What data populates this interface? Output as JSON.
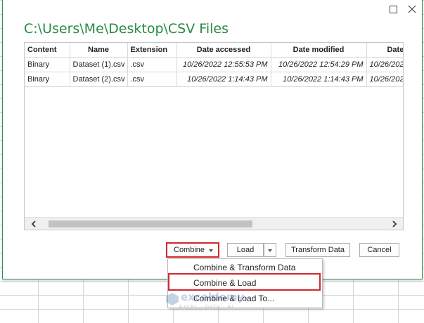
{
  "dialog": {
    "path_title": "C:\\Users\\Me\\Desktop\\CSV Files"
  },
  "table": {
    "columns": [
      "Content",
      "Name",
      "Extension",
      "Date accessed",
      "Date modified",
      "Date c"
    ],
    "rows": [
      {
        "content": "Binary",
        "name": "Dataset (1).csv",
        "extension": ".csv",
        "date_accessed": "10/26/2022 12:55:53 PM",
        "date_modified": "10/26/2022 12:54:29 PM",
        "date_created": "10/26/202"
      },
      {
        "content": "Binary",
        "name": "Dataset (2).csv",
        "extension": ".csv",
        "date_accessed": "10/26/2022 1:14:43 PM",
        "date_modified": "10/26/2022 1:14:43 PM",
        "date_created": "10/26/202"
      }
    ]
  },
  "buttons": {
    "combine": "Combine",
    "load": "Load",
    "transform": "Transform Data",
    "cancel": "Cancel"
  },
  "dropdown": {
    "items": [
      "Combine & Transform Data",
      "Combine & Load",
      "Combine & Load To..."
    ]
  },
  "watermark": {
    "brand": "exceldemy",
    "tagline": "EXCEL · DATA · BI"
  },
  "icons": {
    "maximize": "maximize-icon",
    "close": "close-icon",
    "caret": "caret-down-icon",
    "scroll_left": "chevron-left-icon",
    "scroll_right": "chevron-right-icon"
  },
  "colors": {
    "title_green": "#2a8a46",
    "highlight_red": "#d2282a"
  }
}
